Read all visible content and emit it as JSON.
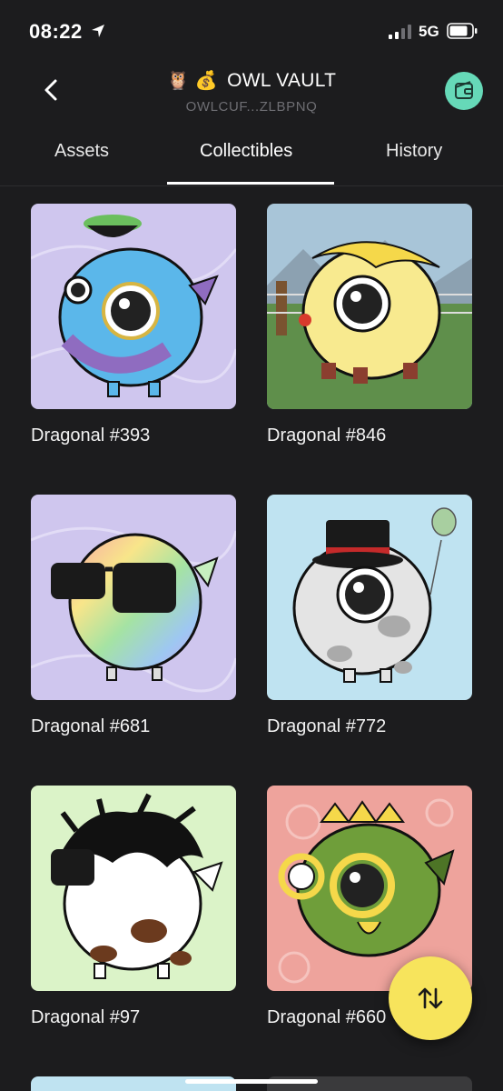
{
  "status_bar": {
    "time": "08:22",
    "network": "5G"
  },
  "header": {
    "title_emoji": "🦉 💰",
    "title": "OWL VAULT",
    "subtitle": "OWLCUF...ZLBPNQ"
  },
  "tabs": [
    {
      "label": "Assets"
    },
    {
      "label": "Collectibles"
    },
    {
      "label": "History"
    }
  ],
  "active_tab": "Collectibles",
  "collectibles": [
    {
      "name": "Dragonal #393",
      "bg": "#cfc6ee",
      "body": "#5bb7ea"
    },
    {
      "name": "Dragonal #846",
      "bg": "#5f8f4b",
      "body": "#f8ea8f"
    },
    {
      "name": "Dragonal #681",
      "bg": "#cfc6ee",
      "body": "#9fd7a7"
    },
    {
      "name": "Dragonal #772",
      "bg": "#bfe3f1",
      "body": "#e4e4e4"
    },
    {
      "name": "Dragonal #97",
      "bg": "#dbf3c8",
      "body": "#ffffff"
    },
    {
      "name": "Dragonal #660",
      "bg": "#eea39c",
      "body": "#6f9e3a"
    }
  ],
  "colors": {
    "background": "#1c1c1e",
    "accent_wallet": "#66d9b8",
    "fab": "#f7e45c"
  },
  "icons": [
    "location-arrow-icon",
    "signal-icon",
    "battery-icon",
    "back-chevron-icon",
    "wallet-icon",
    "swap-arrows-icon"
  ]
}
